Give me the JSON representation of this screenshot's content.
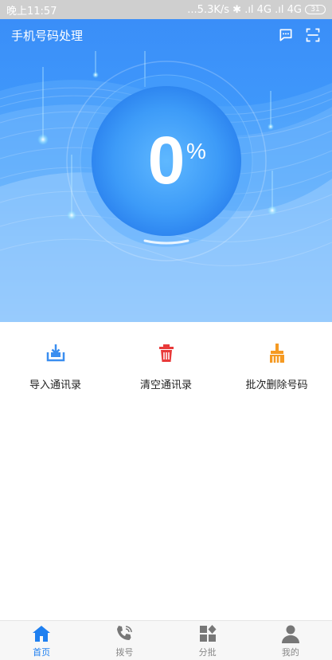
{
  "status_bar": {
    "time": "晚上11:57",
    "network": "...5.3K/s ✱ .ıl 4G .ıl 4G",
    "battery": "31"
  },
  "app_bar": {
    "title": "手机号码处理",
    "icons": [
      "chat-icon",
      "scan-icon"
    ]
  },
  "progress": {
    "value": "0",
    "unit": "%"
  },
  "actions": [
    {
      "label": "导入通讯录",
      "icon": "import-icon",
      "color": "#3a8ef0"
    },
    {
      "label": "清空通讯录",
      "icon": "trash-icon",
      "color": "#e83a3a"
    },
    {
      "label": "批次删除号码",
      "icon": "broom-icon",
      "color": "#f59a23"
    }
  ],
  "bottom_nav": {
    "items": [
      {
        "label": "首页",
        "icon": "home-icon",
        "active": true
      },
      {
        "label": "拨号",
        "icon": "phone-icon",
        "active": false
      },
      {
        "label": "分批",
        "icon": "grid-icon",
        "active": false
      },
      {
        "label": "我的",
        "icon": "user-icon",
        "active": false
      }
    ]
  },
  "colors": {
    "primary": "#3a8ef8",
    "nav_active": "#1e7ff0",
    "nav_inactive": "#888888"
  }
}
